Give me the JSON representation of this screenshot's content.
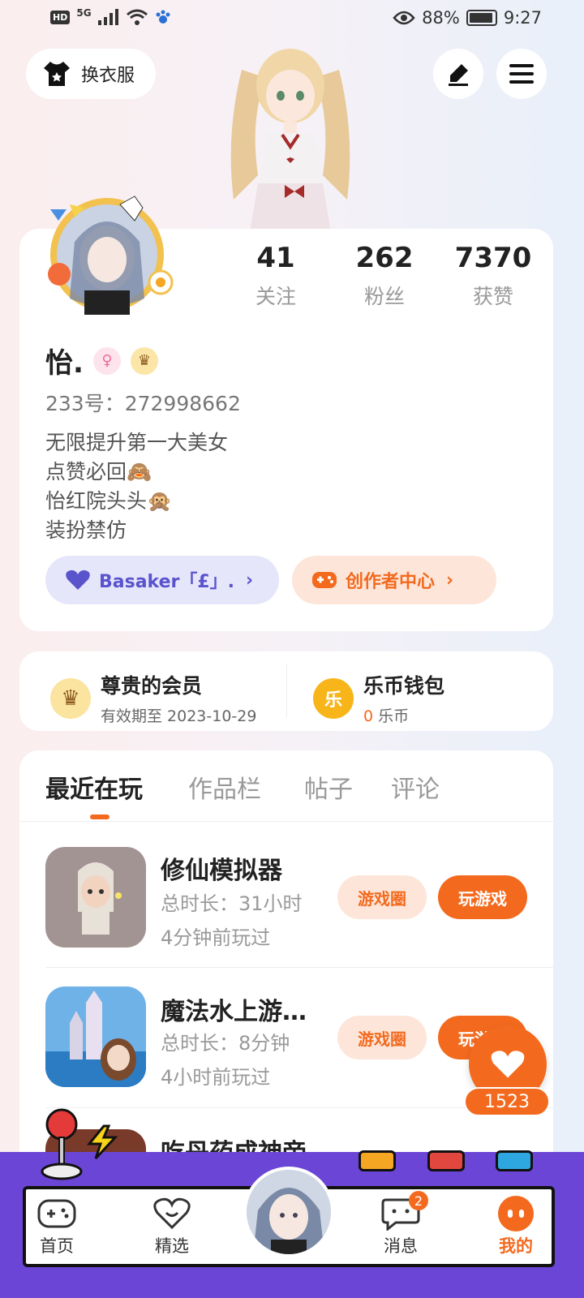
{
  "status_bar": {
    "network": "5G",
    "hd": "HD",
    "battery_pct": "88%",
    "time": "9:27"
  },
  "header": {
    "dress_label": "换衣服"
  },
  "profile": {
    "stats": [
      {
        "value": "41",
        "label": "关注"
      },
      {
        "value": "262",
        "label": "粉丝"
      },
      {
        "value": "7370",
        "label": "获赞"
      }
    ],
    "name": "怡.",
    "uid": "233号：272998662",
    "bio_lines": [
      "无限提升第一大美女",
      "点赞必回🙈",
      "怡红院头头🙊",
      "装扮禁仿"
    ],
    "guild_label": "Basaker「£」.",
    "creator_label": "创作者中心"
  },
  "membership": {
    "title": "尊贵的会员",
    "expiry": "有效期至 2023-10-29",
    "wallet_title": "乐币钱包",
    "wallet_amount": "0",
    "wallet_unit": "乐币",
    "coin_glyph": "乐"
  },
  "tabs": [
    "最近在玩",
    "作品栏",
    "帖子",
    "评论"
  ],
  "games": [
    {
      "title": "修仙模拟器",
      "duration": "总时长：31小时",
      "last_played": "4分钟前玩过"
    },
    {
      "title": "魔法水上游…",
      "duration": "总时长：8分钟",
      "last_played": "4小时前玩过"
    },
    {
      "title": "吃丹药成神帝",
      "duration": "",
      "last_played": ""
    }
  ],
  "buttons": {
    "circle": "游戏圈",
    "play": "玩游戏"
  },
  "like": {
    "count": "1523"
  },
  "nav": {
    "items": [
      {
        "label": "首页"
      },
      {
        "label": "精选"
      },
      {
        "label": "消息",
        "badge": "2"
      },
      {
        "label": "我的"
      }
    ]
  },
  "colors": {
    "accent": "#f36a1e",
    "nav_purple": "#6b46d6",
    "guild_purple": "#5a54cc"
  }
}
